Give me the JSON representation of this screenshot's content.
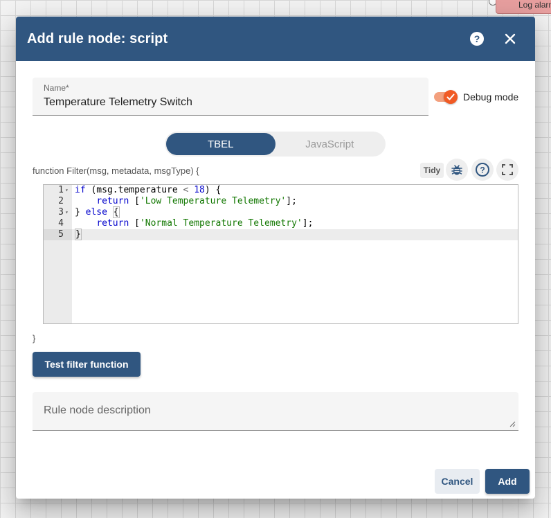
{
  "background": {
    "node_label": "Log alarm"
  },
  "dialog": {
    "title": "Add rule node: script",
    "help_icon": "help-circle-icon",
    "close_icon": "close-icon"
  },
  "name_field": {
    "label": "Name*",
    "value": "Temperature Telemetry Switch"
  },
  "debug": {
    "label": "Debug mode",
    "enabled": true,
    "accent": "#f15a24"
  },
  "language": {
    "options": [
      "TBEL",
      "JavaScript"
    ],
    "selected": "TBEL"
  },
  "script": {
    "header": "function Filter(msg, metadata, msgType) {",
    "footer": "}",
    "tidy_label": "Tidy",
    "icons": [
      "bug-icon",
      "help-circle-icon",
      "fullscreen-icon"
    ],
    "lines": [
      "if (msg.temperature < 18) {",
      "    return ['Low Temperature Telemetry'];",
      "} else {",
      "    return ['Normal Temperature Telemetry'];",
      "}"
    ],
    "line_numbers": [
      "1",
      "2",
      "3",
      "4",
      "5"
    ]
  },
  "test_button": {
    "label": "Test filter function"
  },
  "description": {
    "placeholder": "Rule node description"
  },
  "actions": {
    "cancel_label": "Cancel",
    "add_label": "Add"
  },
  "colors": {
    "primary": "#305680"
  }
}
